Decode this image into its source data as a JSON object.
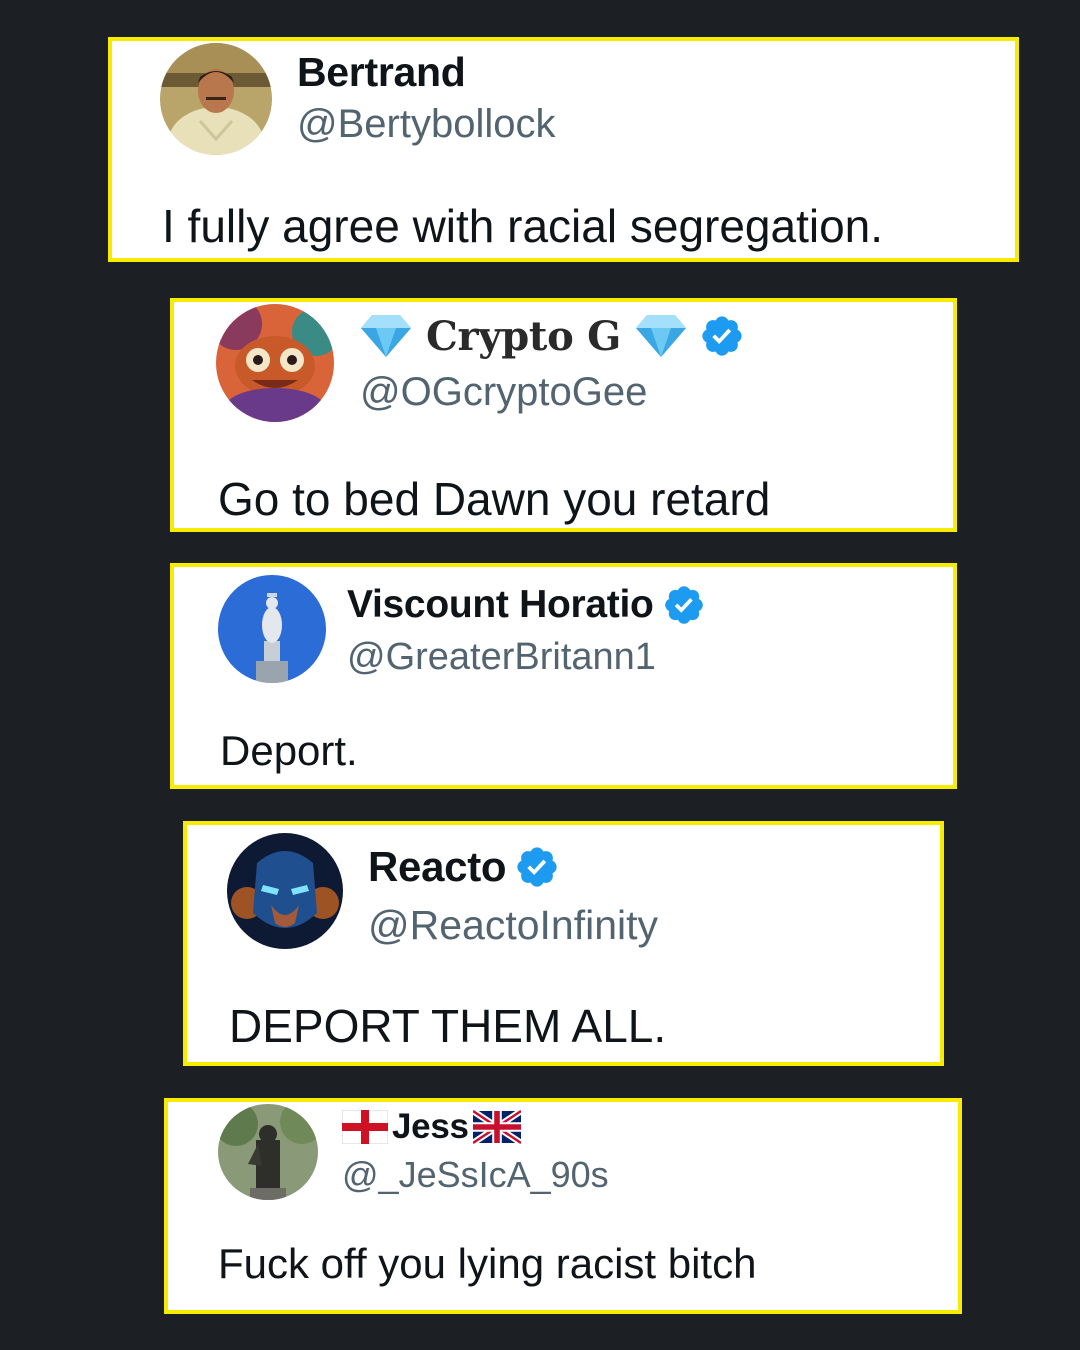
{
  "colors": {
    "background": "#1c1f24",
    "highlight_border": "#f7ec00",
    "name": "#0f1419",
    "handle": "#536471",
    "verified": "#1d9bf0"
  },
  "tweets": [
    {
      "name": "Bertrand",
      "handle": "@Bertybollock",
      "text": "I fully agree with racial segregation.",
      "verified": false,
      "avatar_icon": "man-in-suit-avatar"
    },
    {
      "name": "Crypto G",
      "name_prefix_icon": "diamond-icon",
      "name_suffix_icon": "diamond-icon",
      "handle": "@OGcryptoGee",
      "text": "Go to bed Dawn you retard",
      "verified": true,
      "avatar_icon": "psychedelic-creature-avatar"
    },
    {
      "name": "Viscount Horatio",
      "handle": "@GreaterBritann1",
      "text": "Deport.",
      "verified": true,
      "avatar_icon": "nelson-statue-avatar"
    },
    {
      "name": "Reacto",
      "handle": "@ReactoInfinity",
      "text": "DEPORT THEM ALL.",
      "verified": true,
      "avatar_icon": "robot-hero-avatar"
    },
    {
      "name": "Jess",
      "name_prefix_icon": "england-flag-icon",
      "name_suffix_icon": "uk-flag-icon",
      "handle": "@_JeSsIcA_90s",
      "text": "Fuck off you lying racist bitch",
      "verified": false,
      "avatar_icon": "statue-avatar"
    }
  ]
}
